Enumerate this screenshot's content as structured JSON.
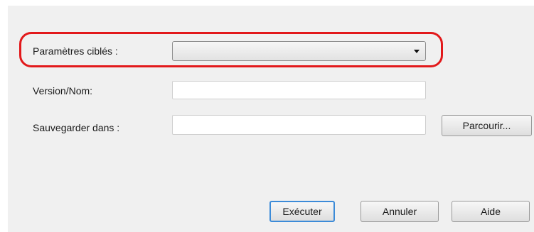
{
  "form": {
    "target_settings": {
      "label": "Paramètres ciblés :",
      "selected_value": ""
    },
    "version_name": {
      "label": "Version/Nom:",
      "value": ""
    },
    "save_in": {
      "label": "Sauvegarder dans :",
      "value": ""
    },
    "browse_label": "Parcourir..."
  },
  "actions": {
    "execute_label": "Exécuter",
    "cancel_label": "Annuler",
    "help_label": "Aide"
  },
  "colors": {
    "highlight": "#e2191b",
    "dialog_background": "#f0f0f0",
    "default_button_border": "#3c8bd8"
  }
}
